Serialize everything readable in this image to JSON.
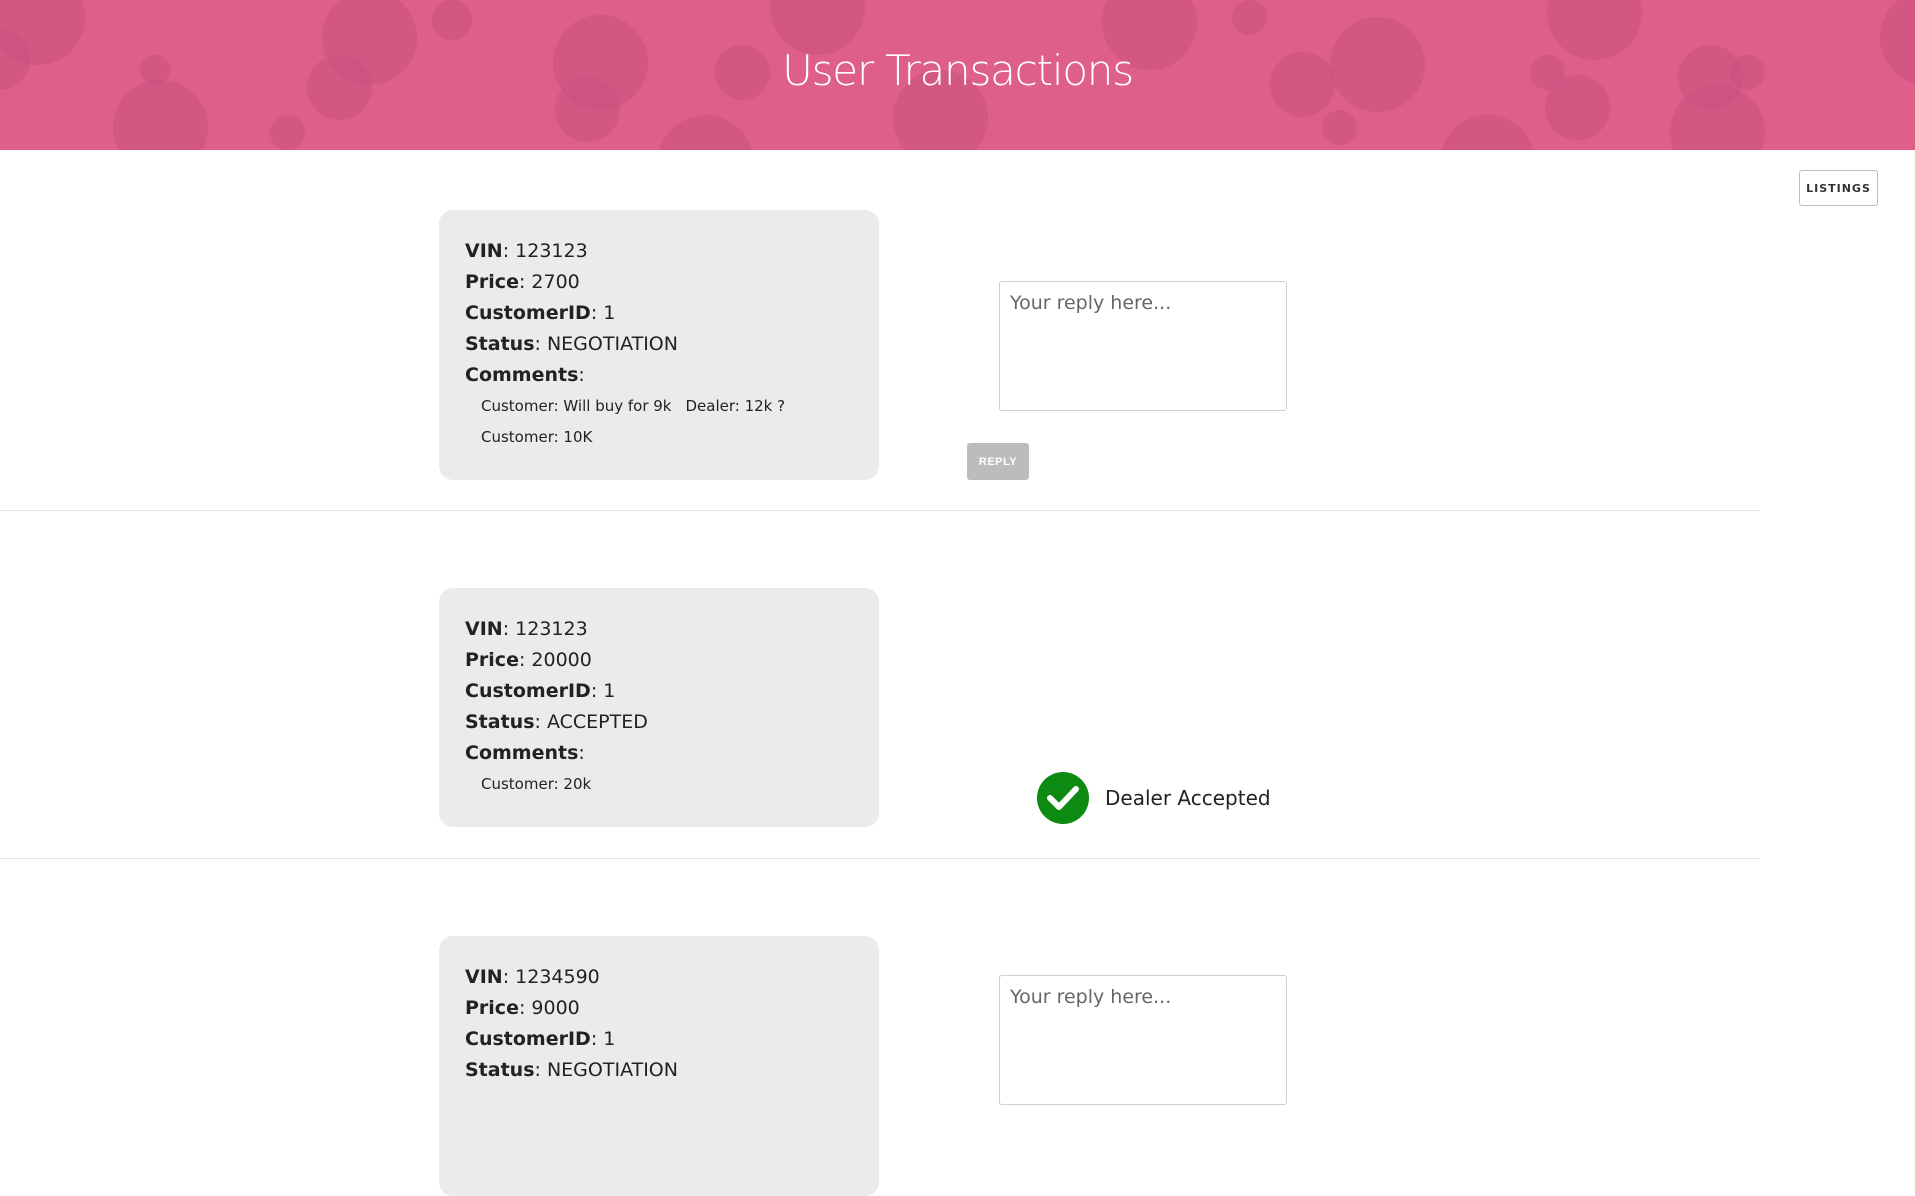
{
  "header": {
    "title": "User Transactions"
  },
  "nav": {
    "listings_label": "LISTINGS"
  },
  "labels": {
    "vin": "VIN",
    "price": "Price",
    "customer_id": "CustomerID",
    "status": "Status",
    "comments": "Comments",
    "reply_placeholder": "Your reply here...",
    "reply_button": "REPLY",
    "dealer_accepted": "Dealer Accepted"
  },
  "transactions": [
    {
      "vin": "123123",
      "price": "2700",
      "customer_id": "1",
      "status": "NEGOTIATION",
      "comments": [
        "Customer: Will buy for 9k",
        "Dealer: 12k ?",
        "Customer: 10K"
      ]
    },
    {
      "vin": "123123",
      "price": "20000",
      "customer_id": "1",
      "status": "ACCEPTED",
      "comments": [
        "Customer: 20k"
      ]
    },
    {
      "vin": "1234590",
      "price": "9000",
      "customer_id": "1",
      "status": "NEGOTIATION",
      "comments": []
    }
  ],
  "colors": {
    "header_bg": "#de5f89",
    "card_bg": "#ebebeb",
    "accept_green": "#0c8a12",
    "reply_button_bg": "#bcbcbc"
  },
  "icons": {
    "accepted": "check-circle-icon"
  }
}
